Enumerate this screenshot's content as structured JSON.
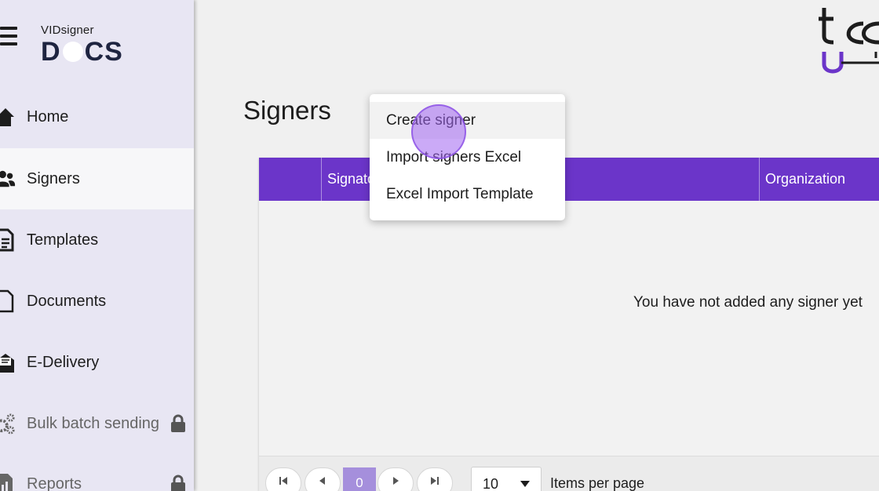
{
  "app": {
    "logo_small": "VIDsigner",
    "logo_big_left": "D",
    "logo_big_right": "CS"
  },
  "sidebar": {
    "items": [
      {
        "label": "Home",
        "icon": "home-icon"
      },
      {
        "label": "Signers",
        "icon": "users-icon",
        "active": true
      },
      {
        "label": "Templates",
        "icon": "file-text-icon"
      },
      {
        "label": "Documents",
        "icon": "file-icon"
      },
      {
        "label": "E-Delivery",
        "icon": "envelope-open-icon"
      },
      {
        "label": "Bulk batch sending",
        "icon": "gears-icon",
        "locked": true
      },
      {
        "label": "Reports",
        "icon": "report-icon",
        "locked": true
      }
    ]
  },
  "page": {
    "title": "Signers"
  },
  "table": {
    "columns": [
      "",
      "Signato",
      "Organization"
    ],
    "empty_message": "You have not added any signer yet"
  },
  "pager": {
    "current_page": "0",
    "page_size": "10",
    "items_per_page_label": "Items per page"
  },
  "menu": {
    "items": [
      "Create signer",
      "Import signers Excel",
      "Excel Import Template"
    ]
  },
  "colors": {
    "accent": "#6b35c9",
    "sidebar_bg": "#e8e6f3",
    "pager_current": "#a58fdc"
  }
}
